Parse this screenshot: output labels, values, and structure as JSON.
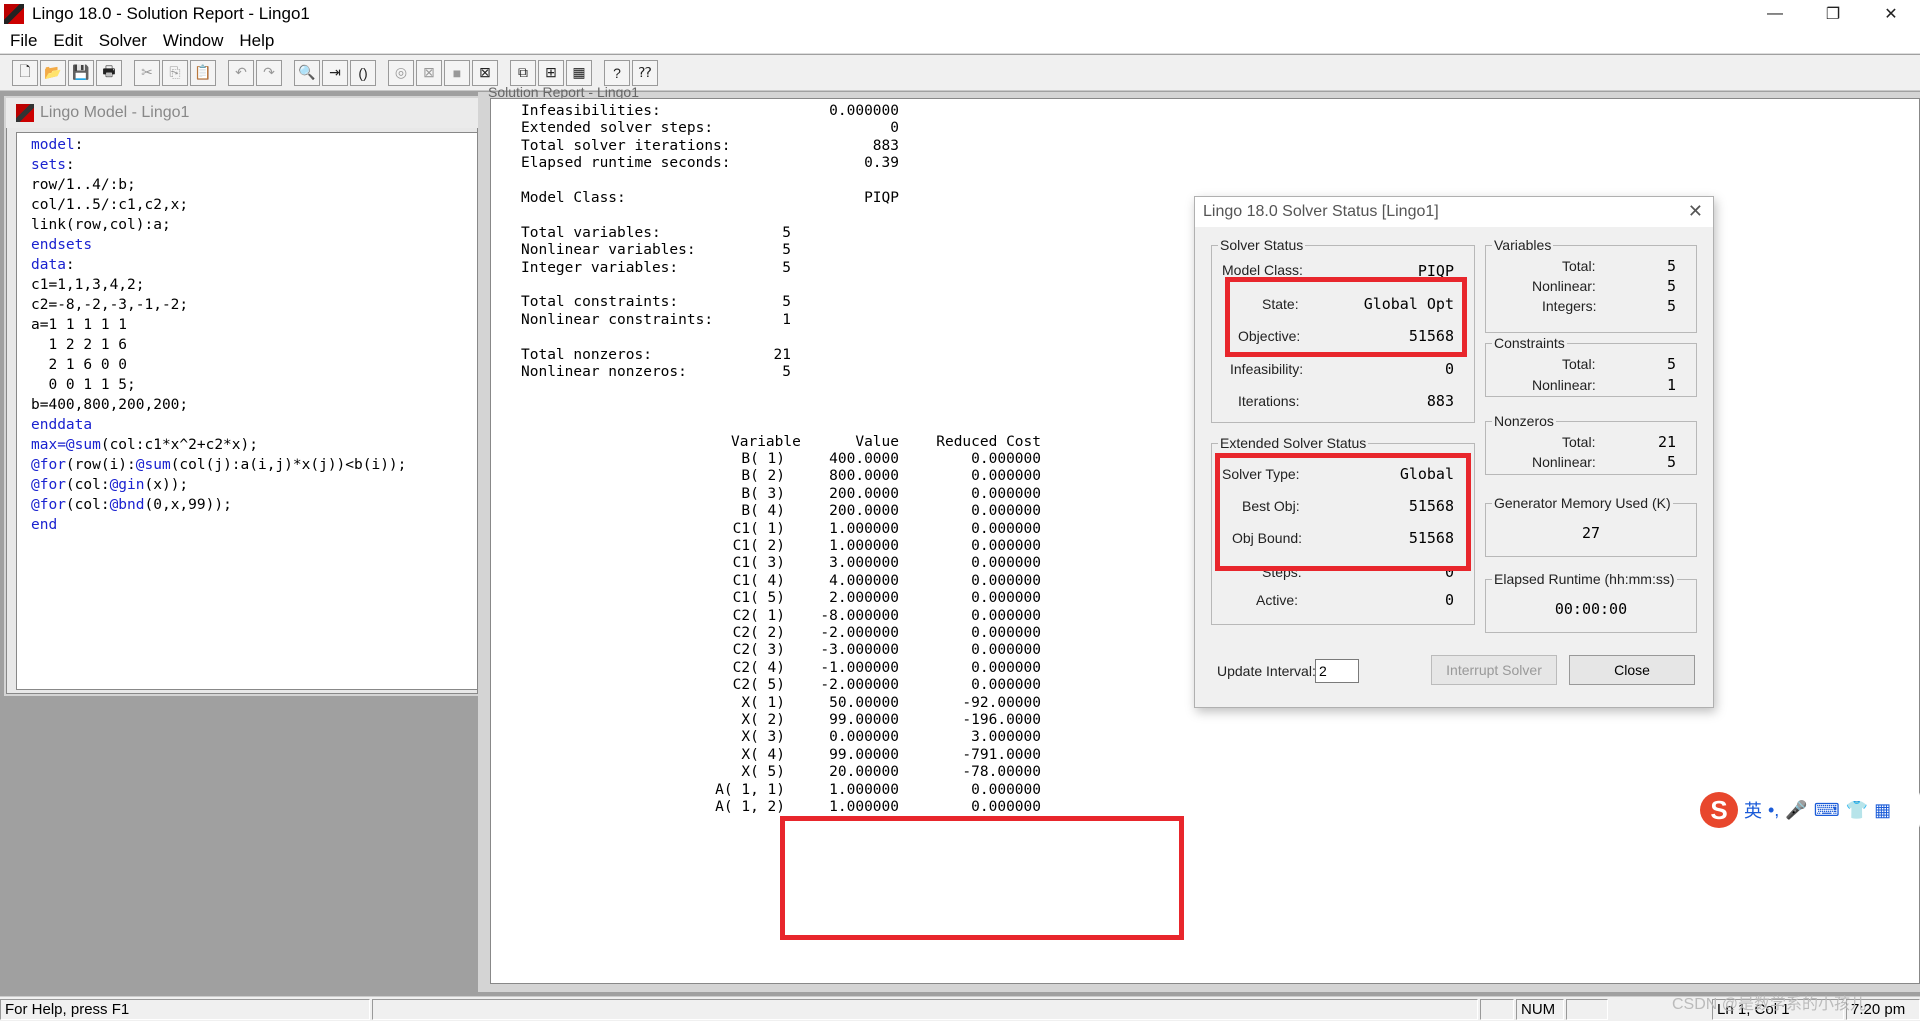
{
  "window": {
    "title": "Lingo 18.0 - Solution Report - Lingo1",
    "min": "—",
    "max": "❐",
    "close": "✕"
  },
  "menu": [
    "File",
    "Edit",
    "Solver",
    "Window",
    "Help"
  ],
  "toolbar": [
    "new-icon",
    "open-icon",
    "save-icon",
    "print-icon",
    "|",
    "cut-icon",
    "copy-icon",
    "paste-icon",
    "|",
    "undo-icon",
    "redo-icon",
    "|",
    "find-icon",
    "goto-icon",
    "match-paren-icon",
    "|",
    "solve-icon",
    "stop-icon",
    "record-icon",
    "close-all-icon",
    "|",
    "send-to-back-icon",
    "tile-icon",
    "cascade-icon",
    "|",
    "help-icon",
    "context-help-icon"
  ],
  "model_window": {
    "title": "Lingo Model - Lingo1",
    "lines": [
      [
        {
          "t": "model",
          "k": 1
        },
        {
          "t": ":",
          "k": 0
        }
      ],
      [
        {
          "t": "sets",
          "k": 1
        },
        {
          "t": ":",
          "k": 0
        }
      ],
      [
        {
          "t": "row/1..4/:b;",
          "k": 0
        }
      ],
      [
        {
          "t": "col/1..5/:c1,c2,x;",
          "k": 0
        }
      ],
      [
        {
          "t": "link(row,col):a;",
          "k": 0
        }
      ],
      [
        {
          "t": "endsets",
          "k": 1
        }
      ],
      [
        {
          "t": "data",
          "k": 1
        },
        {
          "t": ":",
          "k": 0
        }
      ],
      [
        {
          "t": "c1=1,1,3,4,2;",
          "k": 0
        }
      ],
      [
        {
          "t": "c2=-8,-2,-3,-1,-2;",
          "k": 0
        }
      ],
      [
        {
          "t": "a=1 1 1 1 1",
          "k": 0
        }
      ],
      [
        {
          "t": "  1 2 2 1 6",
          "k": 0
        }
      ],
      [
        {
          "t": "  2 1 6 0 0",
          "k": 0
        }
      ],
      [
        {
          "t": "  0 0 1 1 5;",
          "k": 0
        }
      ],
      [
        {
          "t": "b=400,800,200,200;",
          "k": 0
        }
      ],
      [
        {
          "t": "enddata",
          "k": 1
        }
      ],
      [
        {
          "t": "max=@sum",
          "k": 1
        },
        {
          "t": "(col:c1*x^2+c2*x);",
          "k": 0
        }
      ],
      [
        {
          "t": "@for",
          "k": 1
        },
        {
          "t": "(row(i):",
          "k": 0
        },
        {
          "t": "@sum",
          "k": 1
        },
        {
          "t": "(col(j):a(i,j)*x(j))<b(i));",
          "k": 0
        }
      ],
      [
        {
          "t": "@for",
          "k": 1
        },
        {
          "t": "(col:",
          "k": 0
        },
        {
          "t": "@gin",
          "k": 1
        },
        {
          "t": "(x));",
          "k": 0
        }
      ],
      [
        {
          "t": "@for",
          "k": 1
        },
        {
          "t": "(col:",
          "k": 0
        },
        {
          "t": "@bnd",
          "k": 1
        },
        {
          "t": "(0,x,99));",
          "k": 0
        }
      ],
      [
        {
          "t": "end",
          "k": 1
        }
      ]
    ]
  },
  "report": {
    "title": "Solution Report - Lingo1",
    "summary": [
      {
        "label": "Infeasibilities:",
        "value": "0.000000",
        "col": "a"
      },
      {
        "label": "Extended solver steps:",
        "value": "0",
        "col": "a"
      },
      {
        "label": "Total solver iterations:",
        "value": "883",
        "col": "a"
      },
      {
        "label": "Elapsed runtime seconds:",
        "value": "0.39",
        "col": "a"
      },
      {
        "label": "",
        "value": "",
        "col": "a"
      },
      {
        "label": "Model Class:",
        "value": "PIQP",
        "col": "a"
      },
      {
        "label": "",
        "value": "",
        "col": "a"
      },
      {
        "label": "Total variables:",
        "value": "5",
        "col": "b"
      },
      {
        "label": "Nonlinear variables:",
        "value": "5",
        "col": "b"
      },
      {
        "label": "Integer variables:",
        "value": "5",
        "col": "b"
      },
      {
        "label": "",
        "value": "",
        "col": "b"
      },
      {
        "label": "Total constraints:",
        "value": "5",
        "col": "b"
      },
      {
        "label": "Nonlinear constraints:",
        "value": "1",
        "col": "b"
      },
      {
        "label": "",
        "value": "",
        "col": "b"
      },
      {
        "label": "Total nonzeros:",
        "value": "21",
        "col": "b"
      },
      {
        "label": "Nonlinear nonzeros:",
        "value": "5",
        "col": "b"
      }
    ],
    "table_headers": [
      "Variable",
      "Value",
      "Reduced Cost"
    ],
    "rows": [
      [
        "B( 1)",
        "400.0000",
        "0.000000"
      ],
      [
        "B( 2)",
        "800.0000",
        "0.000000"
      ],
      [
        "B( 3)",
        "200.0000",
        "0.000000"
      ],
      [
        "B( 4)",
        "200.0000",
        "0.000000"
      ],
      [
        "C1( 1)",
        "1.000000",
        "0.000000"
      ],
      [
        "C1( 2)",
        "1.000000",
        "0.000000"
      ],
      [
        "C1( 3)",
        "3.000000",
        "0.000000"
      ],
      [
        "C1( 4)",
        "4.000000",
        "0.000000"
      ],
      [
        "C1( 5)",
        "2.000000",
        "0.000000"
      ],
      [
        "C2( 1)",
        "-8.000000",
        "0.000000"
      ],
      [
        "C2( 2)",
        "-2.000000",
        "0.000000"
      ],
      [
        "C2( 3)",
        "-3.000000",
        "0.000000"
      ],
      [
        "C2( 4)",
        "-1.000000",
        "0.000000"
      ],
      [
        "C2( 5)",
        "-2.000000",
        "0.000000"
      ],
      [
        "X( 1)",
        "50.00000",
        "-92.00000"
      ],
      [
        "X( 2)",
        "99.00000",
        "-196.0000"
      ],
      [
        "X( 3)",
        "0.000000",
        "3.000000"
      ],
      [
        "X( 4)",
        "99.00000",
        "-791.0000"
      ],
      [
        "X( 5)",
        "20.00000",
        "-78.00000"
      ],
      [
        "A( 1, 1)",
        "1.000000",
        "0.000000"
      ],
      [
        "A( 1, 2)",
        "1.000000",
        "0.000000"
      ]
    ]
  },
  "solver_status": {
    "title": "Lingo 18.0 Solver Status [Lingo1]",
    "close_icon": "✕",
    "solver_status_caption": "Solver Status",
    "model_class_label": "Model Class:",
    "model_class": "PIQP",
    "state_label": "State:",
    "state": "Global Opt",
    "objective_label": "Objective:",
    "objective": "51568",
    "infeasibility_label": "Infeasibility:",
    "infeasibility": "0",
    "iterations_label": "Iterations:",
    "iterations": "883",
    "variables_caption": "Variables",
    "var_total_label": "Total:",
    "var_total": "5",
    "var_nonlinear_label": "Nonlinear:",
    "var_nonlinear": "5",
    "var_integers_label": "Integers:",
    "var_integers": "5",
    "constraints_caption": "Constraints",
    "con_total_label": "Total:",
    "con_total": "5",
    "con_nonlinear_label": "Nonlinear:",
    "con_nonlinear": "1",
    "nonzeros_caption": "Nonzeros",
    "nz_total_label": "Total:",
    "nz_total": "21",
    "nz_nonlinear_label": "Nonlinear:",
    "nz_nonlinear": "5",
    "ext_caption": "Extended Solver Status",
    "solver_type_label": "Solver Type:",
    "solver_type": "Global",
    "best_obj_label": "Best Obj:",
    "best_obj": "51568",
    "obj_bound_label": "Obj Bound:",
    "obj_bound": "51568",
    "steps_label": "Steps:",
    "steps": "0",
    "active_label": "Active:",
    "active": "0",
    "gen_mem_caption": "Generator Memory Used (K)",
    "gen_mem": "27",
    "elapsed_caption": "Elapsed Runtime (hh:mm:ss)",
    "elapsed": "00:00:00",
    "update_interval_label": "Update Interval:",
    "update_interval": "2",
    "interrupt_button": "Interrupt Solver",
    "close_button": "Close"
  },
  "status_bar": {
    "help": "For Help, press F1",
    "num": "NUM",
    "pos": "Ln 1, Col 1",
    "time": "7:20 pm"
  },
  "ime": {
    "lang": "英",
    "punct": "•,",
    "mic": "🎤",
    "kbd": "⌨",
    "skin": "👕",
    "grid": "▦"
  },
  "watermark": "CSDN @是数学系的小孩儿",
  "colors": {
    "highlight": "#e8262c",
    "keyword": "#1a22d0"
  }
}
